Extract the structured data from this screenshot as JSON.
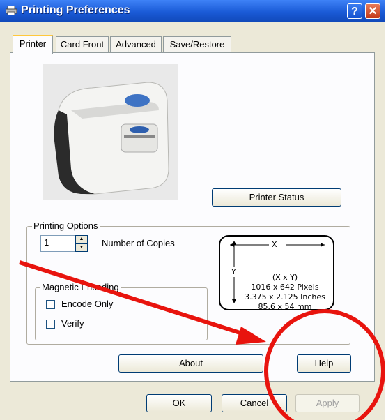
{
  "window": {
    "title": "Printing Preferences",
    "help_btn": "?",
    "close_btn": "✕"
  },
  "tabs": [
    {
      "label": "Printer",
      "active": true
    },
    {
      "label": "Card Front",
      "active": false
    },
    {
      "label": "Advanced",
      "active": false
    },
    {
      "label": "Save/Restore",
      "active": false
    }
  ],
  "printer_status_label": "Printer Status",
  "printing_options": {
    "group_label": "Printing Options",
    "copies_value": "1",
    "copies_label": "Number of Copies",
    "magnetic": {
      "group_label": "Magnetic Encoding",
      "encode_only_label": "Encode Only",
      "encode_only_checked": false,
      "verify_label": "Verify",
      "verify_checked": false
    }
  },
  "card_diagram": {
    "x_label": "X",
    "y_label": "Y",
    "line1": "(X x Y)",
    "line2": "1016 x 642 Pixels",
    "line3": "3.375 x 2.125 Inches",
    "line4": "85.6 x 54 mm"
  },
  "buttons": {
    "about": "About",
    "help": "Help",
    "ok": "OK",
    "cancel": "Cancel",
    "apply": "Apply"
  },
  "annotation": {
    "color": "#e8140e"
  }
}
